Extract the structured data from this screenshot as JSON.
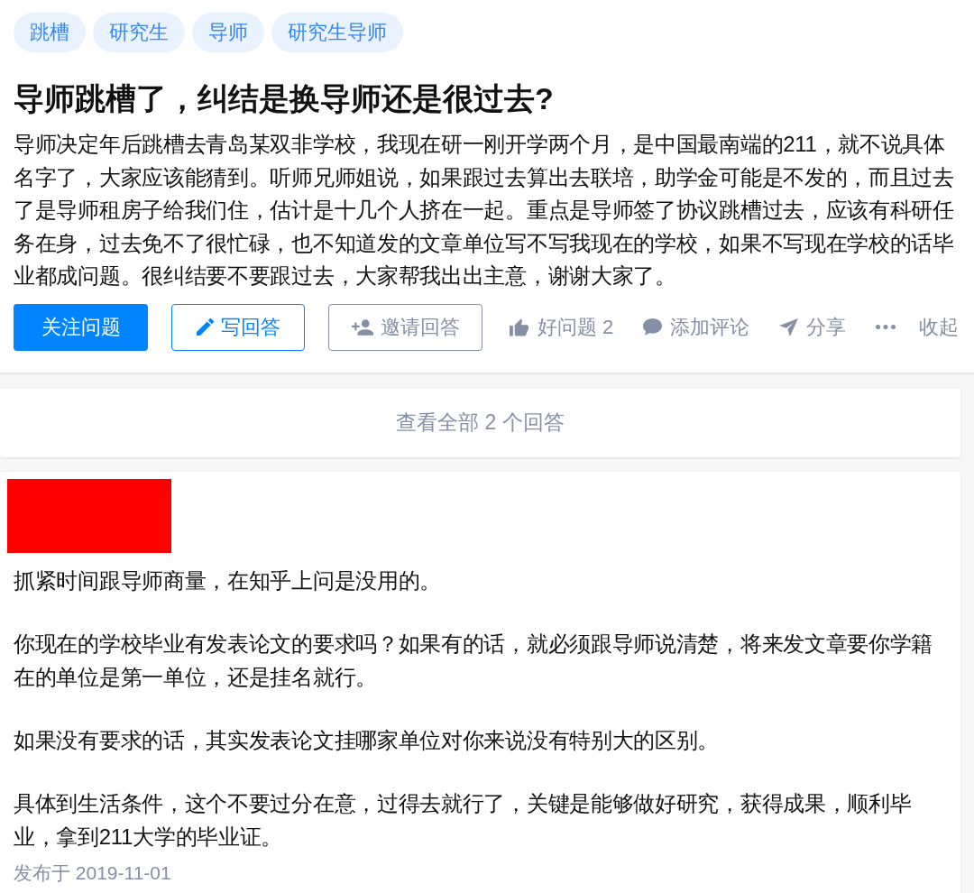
{
  "topics": [
    "跳槽",
    "研究生",
    "导师",
    "研究生导师"
  ],
  "question": {
    "title": "导师跳槽了，纠结是换导师还是很过去?",
    "detail": "导师决定年后跳槽去青岛某双非学校，我现在研一刚开学两个月，是中国最南端的211，就不说具体名字了，大家应该能猜到。听师兄师姐说，如果跟过去算出去联培，助学金可能是不发的，而且过去了是导师租房子给我们住，估计是十几个人挤在一起。重点是导师签了协议跳槽过去，应该有科研任务在身，过去免不了很忙碌，也不知道发的文章单位写不写我现在的学校，如果不写现在学校的话毕业都成问题。很纠结要不要跟过去，大家帮我出出主意，谢谢大家了。"
  },
  "question_actions": [
    {
      "kind": "follow",
      "label": "关注问题"
    },
    {
      "kind": "write",
      "label": "写回答"
    },
    {
      "kind": "invite",
      "label": "邀请回答"
    },
    {
      "kind": "vote",
      "label": "好问题 2"
    },
    {
      "kind": "comment",
      "label": "添加评论"
    },
    {
      "kind": "share",
      "label": "分享"
    },
    {
      "kind": "more"
    },
    {
      "kind": "collapse",
      "label": "收起"
    }
  ],
  "view_all_answers": "查看全部 2 个回答",
  "answer": {
    "paragraphs": [
      "抓紧时间跟导师商量，在知乎上问是没用的。",
      "你现在的学校毕业有发表论文的要求吗？如果有的话，就必须跟导师说清楚，将来发文章要你学籍在的单位是第一单位，还是挂名就行。",
      "如果没有要求的话，其实发表论文挂哪家单位对你来说没有特别大的区别。",
      "具体到生活条件，这个不要过分在意，过得去就行了，关键是能够做好研究，获得成果，顺利毕业，拿到211大学的毕业证。"
    ],
    "published": "发布于 2019-11-01"
  }
}
